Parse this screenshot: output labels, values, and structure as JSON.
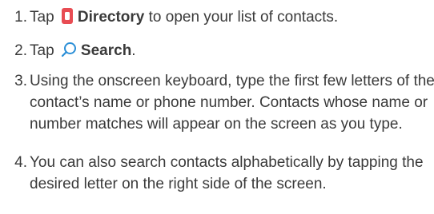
{
  "steps": [
    {
      "number": "1",
      "before": "Tap ",
      "icon": "directory-icon",
      "bold": "Directory",
      "after": " to open your list of contacts."
    },
    {
      "number": "2",
      "before": "Tap ",
      "icon": "search-icon",
      "bold": "Search",
      "after": "."
    },
    {
      "number": "3",
      "text": "Using the onscreen keyboard, type the first few letters of the contact’s name or phone number. Contacts whose name or number matches will appear on the screen as you type."
    },
    {
      "number": "4",
      "text": "You can also search contacts alphabetically by tapping the desired letter on the right side of the screen."
    }
  ],
  "colors": {
    "text": "#3a3a3a",
    "directory_icon": "#e84c53",
    "search_icon": "#2b8fd7"
  }
}
